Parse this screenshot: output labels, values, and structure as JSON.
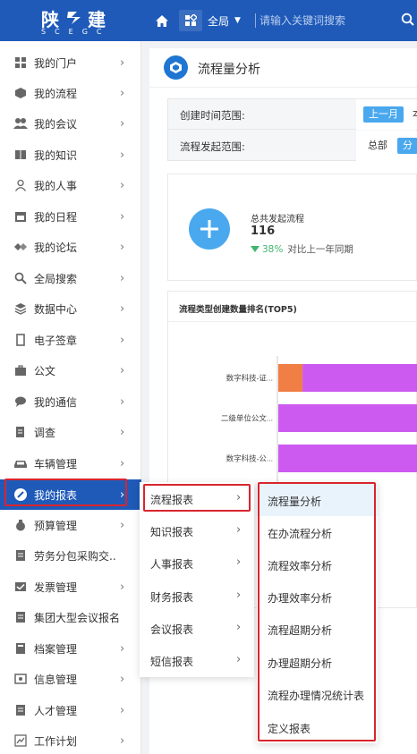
{
  "header": {
    "logo_cn_1": "陕",
    "logo_cn_2": "建",
    "logo_en": "SCEGC",
    "scope_label": "全局",
    "search_placeholder": "请输入关键词搜索",
    "icons": [
      "home-icon",
      "apps-icon",
      "search-icon"
    ],
    "brand_color": "#1f5ab8"
  },
  "sidebar": {
    "items": [
      {
        "label": "我的门户",
        "icon": "portal-icon"
      },
      {
        "label": "我的流程",
        "icon": "workflow-icon"
      },
      {
        "label": "我的会议",
        "icon": "meeting-icon"
      },
      {
        "label": "我的知识",
        "icon": "book-icon"
      },
      {
        "label": "我的人事",
        "icon": "person-icon"
      },
      {
        "label": "我的日程",
        "icon": "calendar-icon"
      },
      {
        "label": "我的论坛",
        "icon": "forum-icon"
      },
      {
        "label": "全局搜索",
        "icon": "search-icon"
      },
      {
        "label": "数据中心",
        "icon": "layers-icon"
      },
      {
        "label": "电子签章",
        "icon": "seal-icon"
      },
      {
        "label": "公文",
        "icon": "briefcase-icon"
      },
      {
        "label": "我的通信",
        "icon": "chat-icon"
      },
      {
        "label": "调查",
        "icon": "survey-icon"
      },
      {
        "label": "车辆管理",
        "icon": "car-icon"
      },
      {
        "label": "我的报表",
        "icon": "report-icon"
      },
      {
        "label": "预算管理",
        "icon": "money-bag-icon"
      },
      {
        "label": "劳务分包采购交...",
        "icon": "document-icon"
      },
      {
        "label": "发票管理",
        "icon": "invoice-icon"
      },
      {
        "label": "集团大型会议报名",
        "icon": "document-icon"
      },
      {
        "label": "档案管理",
        "icon": "archive-icon"
      },
      {
        "label": "信息管理",
        "icon": "info-icon"
      },
      {
        "label": "人才管理",
        "icon": "talent-icon"
      },
      {
        "label": "工作计划",
        "icon": "plan-icon"
      }
    ],
    "active_index": 14
  },
  "main": {
    "page_title": "流程量分析",
    "filters": {
      "time_label": "创建时间范围:",
      "time_active": "上一月",
      "time_next": "本",
      "scope_label": "流程发起范围:",
      "scope_option": "总部",
      "scope_active": "分管"
    },
    "stat": {
      "label": "总共发起流程",
      "value": "116",
      "trend_pct": "38%",
      "trend_text": "对比上一年同期",
      "trend_direction": "down",
      "trend_color": "#3fb56e"
    },
    "chart_title": "流程类型创建数量排名(TOP5)"
  },
  "chart_data": {
    "type": "bar",
    "orientation": "horizontal",
    "title": "流程类型创建数量排名(TOP5)",
    "categories": [
      "数字科技-证...",
      "二级单位公文...",
      "数字科技-公..."
    ],
    "series": [
      {
        "color": "#f07f45",
        "values": [
          5,
          0,
          0
        ]
      },
      {
        "color": "#cc5af0",
        "values": [
          24,
          30,
          30
        ]
      }
    ],
    "xlim": [
      0,
      29
    ]
  },
  "menu_level2": {
    "items": [
      "流程报表",
      "知识报表",
      "人事报表",
      "财务报表",
      "会议报表",
      "短信报表"
    ],
    "active_index": 0
  },
  "menu_level3": {
    "items": [
      "流程量分析",
      "在办流程分析",
      "流程效率分析",
      "办理效率分析",
      "流程超期分析",
      "办理超期分析",
      "流程办理情况统计表",
      "定义报表"
    ],
    "highlight_index": 0,
    "highlight_color": "#e9f3fc"
  },
  "annotation_color": "#d9252e"
}
